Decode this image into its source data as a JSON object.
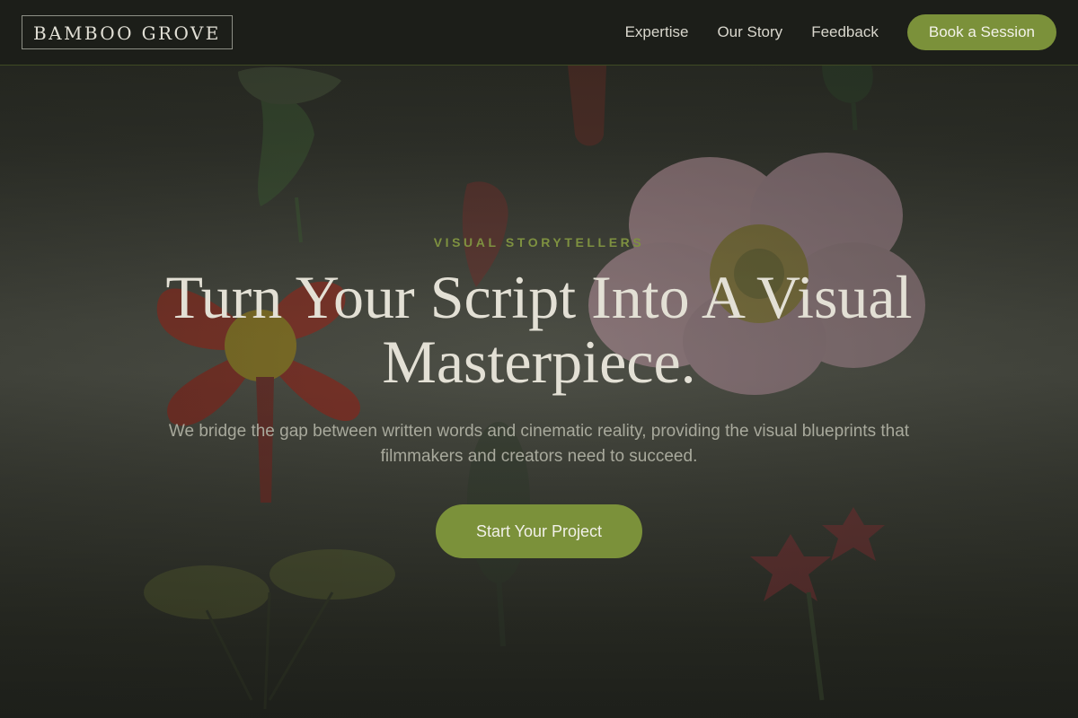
{
  "header": {
    "brand": "BAMBOO GROVE",
    "nav": [
      {
        "label": "Expertise"
      },
      {
        "label": "Our Story"
      },
      {
        "label": "Feedback"
      }
    ],
    "cta_label": "Book a Session"
  },
  "hero": {
    "eyebrow": "VISUAL STORYTELLERS",
    "title": "Turn Your Script Into A Visual Masterpiece.",
    "subtitle": "We bridge the gap between written words and cinematic reality, providing the visual blueprints that filmmakers and creators need to succeed.",
    "cta_label": "Start Your Project",
    "background_image": "botanical-flower-illustration"
  },
  "colors": {
    "accent": "#7b913a",
    "eyebrow": "#7e9140",
    "header_bg": "#1c1e19",
    "title_text": "#e3e0d5",
    "body_text": "#a8a99c"
  }
}
